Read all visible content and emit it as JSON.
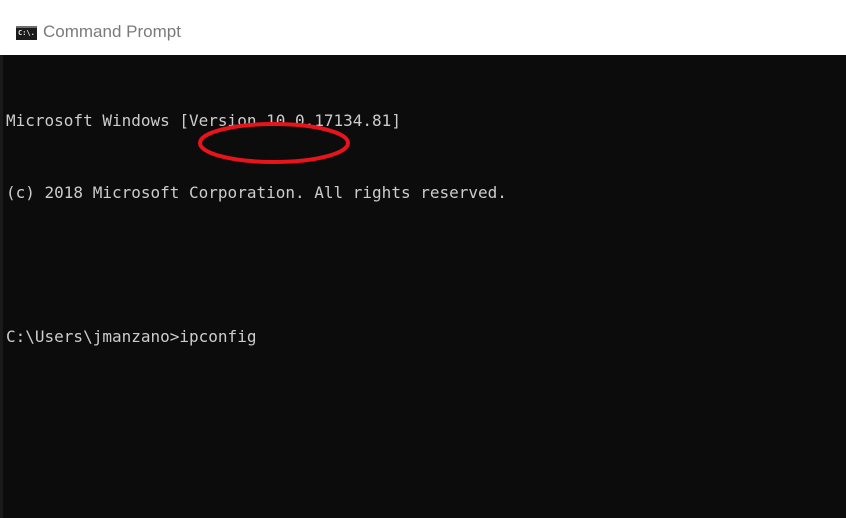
{
  "window": {
    "title": "Command Prompt",
    "icon": "cmd-icon",
    "icon_text": "C:\\."
  },
  "console": {
    "lines": [
      "Microsoft Windows [Version 10.0.17134.81]",
      "(c) 2018 Microsoft Corporation. All rights reserved."
    ],
    "prompt": "C:\\Users\\jmanzano>",
    "command": "ipconfig"
  },
  "annotation": {
    "type": "ellipse-highlight",
    "target": "command",
    "color": "#e8141c"
  },
  "colors": {
    "console_background": "#0c0c0c",
    "console_text": "#cccccc",
    "title_text": "#7a7a7a"
  }
}
